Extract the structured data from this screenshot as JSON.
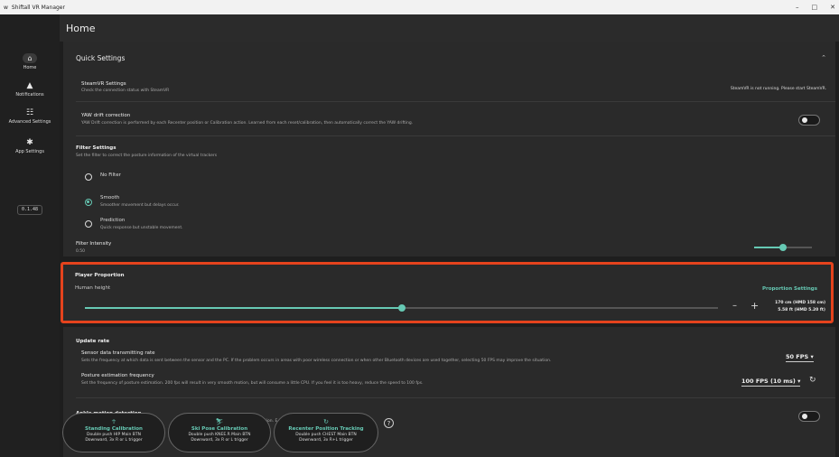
{
  "window": {
    "title": "Shiftall VR Manager",
    "controls": [
      "–",
      "□",
      "✕"
    ]
  },
  "header": {
    "title": "Home"
  },
  "sidebar": {
    "items": [
      {
        "label": "Home",
        "icon": "home-icon"
      },
      {
        "label": "Notifications",
        "icon": "bell-icon"
      },
      {
        "label": "Advanced Settings",
        "icon": "sliders-icon"
      },
      {
        "label": "App Settings",
        "icon": "gear-icon"
      }
    ],
    "version": "0.1.48"
  },
  "quick_settings": {
    "title": "Quick Settings",
    "steamvr": {
      "title": "SteamVR Settings",
      "subtitle": "Check the connection status with SteamVR",
      "status": "SteamVR is not running. Please start SteamVR."
    },
    "yaw": {
      "title": "YAW drift correction",
      "subtitle": "YAW Drift correction is performed by each Recenter position or Calibration action. Learned from each reset/calibration, then automatically correct the YAW drifting.",
      "enabled": false
    },
    "filter": {
      "title": "Filter Settings",
      "subtitle": "Set the filter to correct the posture information of the virtual trackers",
      "options": [
        {
          "label": "No Filter",
          "desc": ""
        },
        {
          "label": "Smooth",
          "desc": "Smoother movement but delays occur."
        },
        {
          "label": "Prediction",
          "desc": "Quick response but unstable movement."
        }
      ],
      "selected": "Smooth",
      "intensity_label": "Filter Intensity",
      "intensity_value": "0.50"
    }
  },
  "player_proportion": {
    "title": "Player Proportion",
    "height_label": "Human height",
    "link": "Proportion Settings",
    "minus": "–",
    "plus": "+",
    "value_cm": "170 cm (HMD 158 cm)",
    "value_ft": "5.58 ft (HMD 5.20 ft)",
    "slider_fraction": 0.5
  },
  "update_rate": {
    "title": "Update rate",
    "transmit": {
      "title": "Sensor data transmitting rate",
      "subtitle": "Sets the frequency at which data is sent between the sensor and the PC. If the problem occurs in areas with poor wireless connection or when other Bluetooth devices are used together, selecting 50 FPS may improve the situation.",
      "value": "50 FPS"
    },
    "posture": {
      "title": "Posture estimation frequency",
      "subtitle": "Set the frequency of posture estimation. 200 fps will result in very smooth motion, but will consume a little CPU. If you feel it is too heavy, reduce the speed to 100 fps.",
      "value": "100 FPS (10 ms)"
    }
  },
  "ankle": {
    "title": "Ankle motion detection",
    "partial_left": "versel",
    "partial_right": "tion. E",
    "enabled": false
  },
  "floating": [
    {
      "title": "Standing Calibration",
      "line1": "Double push HIP Main BTN",
      "line2": "Downward, 3x R or L trigger",
      "icon": "person-icon"
    },
    {
      "title": "Ski Pose Calibration",
      "line1": "Double push KNEE.R Main BTN",
      "line2": "Downward, 3x R or L trigger",
      "icon": "ski-icon"
    },
    {
      "title": "Recenter Position Tracking",
      "line1": "Double push CHEST Main BTN",
      "line2": "Downward, 3x R+L trigger",
      "icon": "recenter-icon"
    }
  ],
  "colors": {
    "accent": "#66c9b4",
    "highlight": "#e5431d"
  }
}
